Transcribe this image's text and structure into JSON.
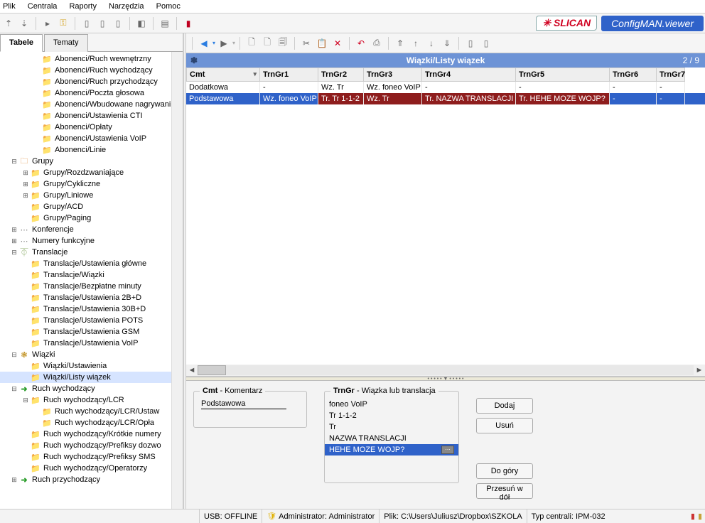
{
  "menu": [
    "Plik",
    "Centrala",
    "Raporty",
    "Narzędzia",
    "Pomoc"
  ],
  "brand": {
    "logo": "SLICAN",
    "title": "ConfigMAN.viewer"
  },
  "left": {
    "tabs": {
      "tab1": "Tabele",
      "tab2": "Tematy"
    },
    "tree": [
      {
        "indent": 2,
        "twist": "",
        "icon": "folder",
        "label": "Abonenci/Ruch wewnętrzny"
      },
      {
        "indent": 2,
        "twist": "",
        "icon": "folder",
        "label": "Abonenci/Ruch wychodzący"
      },
      {
        "indent": 2,
        "twist": "",
        "icon": "folder",
        "label": "Abonenci/Ruch przychodzący"
      },
      {
        "indent": 2,
        "twist": "",
        "icon": "folder",
        "label": "Abonenci/Poczta głosowa"
      },
      {
        "indent": 2,
        "twist": "",
        "icon": "folder",
        "label": "Abonenci/Wbudowane nagrywani"
      },
      {
        "indent": 2,
        "twist": "",
        "icon": "folder",
        "label": "Abonenci/Ustawienia CTI"
      },
      {
        "indent": 2,
        "twist": "",
        "icon": "folder",
        "label": "Abonenci/Opłaty"
      },
      {
        "indent": 2,
        "twist": "",
        "icon": "folder",
        "label": "Abonenci/Ustawienia VoIP"
      },
      {
        "indent": 2,
        "twist": "",
        "icon": "folder",
        "label": "Abonenci/Linie"
      },
      {
        "indent": 0,
        "twist": "⊟",
        "icon": "orange",
        "label": "Grupy"
      },
      {
        "indent": 1,
        "twist": "⊞",
        "icon": "folder",
        "label": "Grupy/Rozdzwaniające"
      },
      {
        "indent": 1,
        "twist": "⊞",
        "icon": "folder",
        "label": "Grupy/Cykliczne"
      },
      {
        "indent": 1,
        "twist": "⊞",
        "icon": "folder",
        "label": "Grupy/Liniowe"
      },
      {
        "indent": 1,
        "twist": "",
        "icon": "folder",
        "label": "Grupy/ACD"
      },
      {
        "indent": 1,
        "twist": "",
        "icon": "folder",
        "label": "Grupy/Paging"
      },
      {
        "indent": 0,
        "twist": "⊞",
        "icon": "dots",
        "label": "Konferencje"
      },
      {
        "indent": 0,
        "twist": "⊞",
        "icon": "dots",
        "label": "Numery funkcyjne"
      },
      {
        "indent": 0,
        "twist": "⊟",
        "icon": "t",
        "label": "Translacje"
      },
      {
        "indent": 1,
        "twist": "",
        "icon": "folder",
        "label": "Translacje/Ustawienia główne"
      },
      {
        "indent": 1,
        "twist": "",
        "icon": "folder",
        "label": "Translacje/Wiązki"
      },
      {
        "indent": 1,
        "twist": "",
        "icon": "folder",
        "label": "Translacje/Bezpłatne minuty"
      },
      {
        "indent": 1,
        "twist": "",
        "icon": "folder",
        "label": "Translacje/Ustawienia 2B+D"
      },
      {
        "indent": 1,
        "twist": "",
        "icon": "folder",
        "label": "Translacje/Ustawienia 30B+D"
      },
      {
        "indent": 1,
        "twist": "",
        "icon": "folder",
        "label": "Translacje/Ustawienia POTS"
      },
      {
        "indent": 1,
        "twist": "",
        "icon": "folder",
        "label": "Translacje/Ustawienia GSM"
      },
      {
        "indent": 1,
        "twist": "",
        "icon": "folder",
        "label": "Translacje/Ustawienia VoIP"
      },
      {
        "indent": 0,
        "twist": "⊟",
        "icon": "bundle",
        "label": "Wiązki"
      },
      {
        "indent": 1,
        "twist": "",
        "icon": "folder",
        "label": "Wiązki/Ustawienia"
      },
      {
        "indent": 1,
        "twist": "",
        "icon": "folder",
        "label": "Wiązki/Listy wiązek",
        "selected": true
      },
      {
        "indent": 0,
        "twist": "⊟",
        "icon": "arrow",
        "label": "Ruch wychodzący"
      },
      {
        "indent": 1,
        "twist": "⊟",
        "icon": "folder",
        "label": "Ruch wychodzący/LCR"
      },
      {
        "indent": 2,
        "twist": "",
        "icon": "folder",
        "label": "Ruch wychodzący/LCR/Ustaw"
      },
      {
        "indent": 2,
        "twist": "",
        "icon": "folder",
        "label": "Ruch wychodzący/LCR/Opła"
      },
      {
        "indent": 1,
        "twist": "",
        "icon": "folder",
        "label": "Ruch wychodzący/Krótkie numery"
      },
      {
        "indent": 1,
        "twist": "",
        "icon": "folder",
        "label": "Ruch wychodzący/Prefiksy dozwo"
      },
      {
        "indent": 1,
        "twist": "",
        "icon": "folder",
        "label": "Ruch wychodzący/Prefiksy SMS"
      },
      {
        "indent": 1,
        "twist": "",
        "icon": "folder",
        "label": "Ruch wychodzący/Operatorzy"
      },
      {
        "indent": 0,
        "twist": "⊞",
        "icon": "arrow",
        "label": "Ruch przychodzący"
      }
    ]
  },
  "grid": {
    "title": "Wiązki/Listy wiązek",
    "count": "2 / 9",
    "headers": [
      "Cmt",
      "TrnGr1",
      "TrnGr2",
      "TrnGr3",
      "TrnGr4",
      "TrnGr5",
      "TrnGr6",
      "TrnGr7"
    ],
    "rows": [
      {
        "sel": false,
        "cells": [
          "Dodatkowa",
          "-",
          "Wz. Tr",
          "Wz. foneo VoIP",
          "-",
          "-",
          "-",
          "-"
        ],
        "red": []
      },
      {
        "sel": true,
        "cells": [
          "Podstawowa",
          "Wz. foneo VoIP",
          "Tr. Tr 1-1-2",
          "Wz. Tr",
          "Tr. NAZWA TRANSLACJI",
          "Tr. HEHE MOZE WOJP?",
          "-",
          "-"
        ],
        "red": [
          2,
          3,
          4,
          5
        ]
      }
    ]
  },
  "detail": {
    "cmt_caption": "Cmt  - Komentarz",
    "cmt_value": "Podstawowa",
    "trn_caption": "TrnGr  - Wiązka lub translacja",
    "list": [
      "foneo VoIP",
      "Tr 1-1-2",
      "Tr",
      "NAZWA TRANSLACJI",
      "HEHE MOZE WOJP?"
    ],
    "list_selected": 4,
    "buttons": {
      "add": "Dodaj",
      "del": "Usuń",
      "up": "Do góry",
      "down": "Przesuń w dół"
    }
  },
  "status": {
    "usb": "USB: OFFLINE",
    "admin": "Administrator: Administrator",
    "file": "Plik: C:\\Users\\Juliusz\\Dropbox\\SZKOLA",
    "type": "Typ centrali: IPM-032"
  }
}
